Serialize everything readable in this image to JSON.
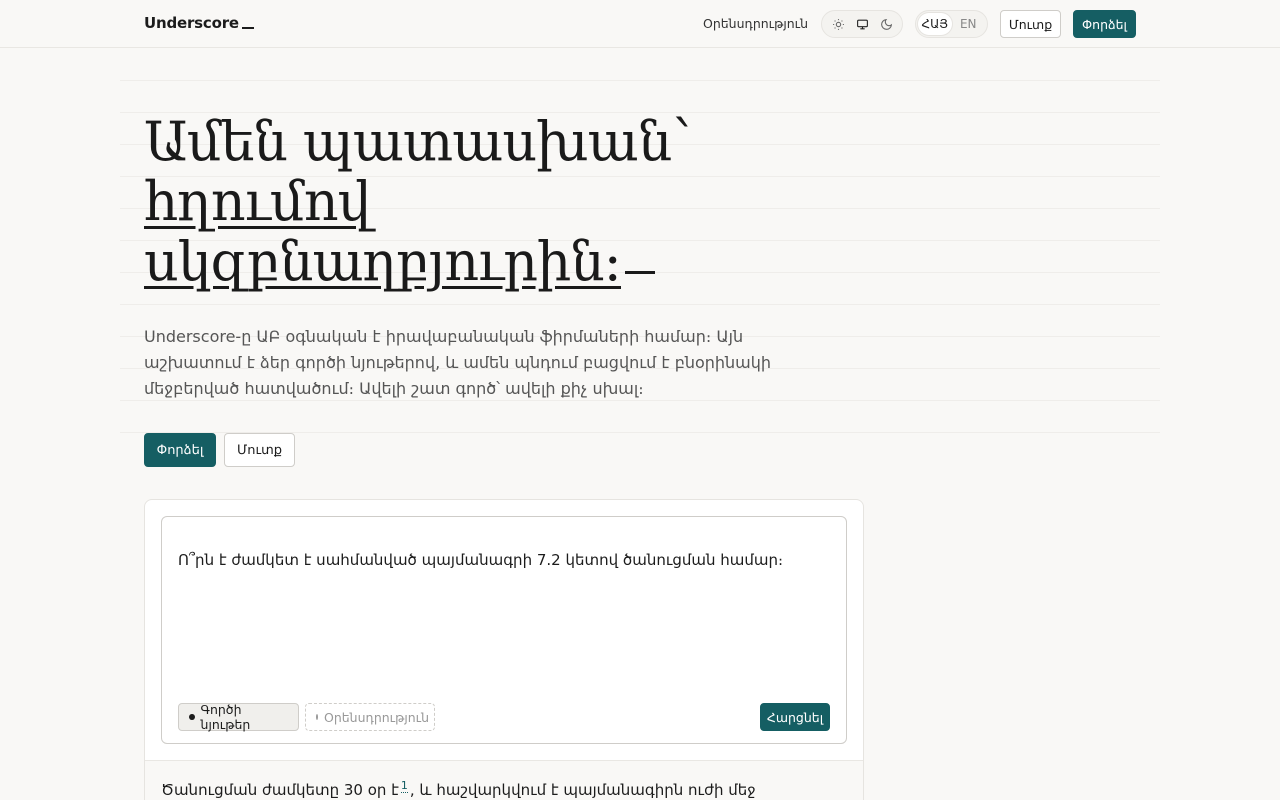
{
  "header": {
    "brand": "Underscore",
    "nav_link": "Օրենսդրություն",
    "theme_icons": [
      "sun-icon",
      "monitor-icon",
      "moon-icon"
    ],
    "languages": [
      "ՀԱՅ",
      "EN"
    ],
    "active_language": "ՀԱՅ",
    "login_label": "Մուտք",
    "try_label": "Փորձել"
  },
  "hero": {
    "title_line1": "Ամեն պատասխան՝",
    "title_line2": "հղումով",
    "title_line3": "սկզբնաղբյուրին։",
    "lead": "Underscore-ը ԱԲ օգնական է իրավաբանական ֆիրմաների համար։ Այն աշխատում է ձեր գործի նյութերով, և ամեն պնդում բացվում է բնօրինակի մեջբերված հատվածում։ Ավելի շատ գործ՝ ավելի քիչ սխալ։",
    "try_label": "Փորձել",
    "login_label": "Մուտք"
  },
  "demo": {
    "question": "Ո՞րն է ժամկետ է սահմանված պայմանագրի 7.2 կետով ծանուցման համար։",
    "chip_active": "Գործի նյութեր",
    "chip_inactive": "Օրենսդրություն",
    "send_label": "Հարցնել",
    "answer_part1": "Ծանուցման ժամկետը 30 օր է",
    "citation": "1",
    "answer_part2": ", և հաշվարկվում է պայմանագիրն ուժի մեջ"
  },
  "colors": {
    "accent": "#155e63",
    "background": "#f9f8f6"
  }
}
